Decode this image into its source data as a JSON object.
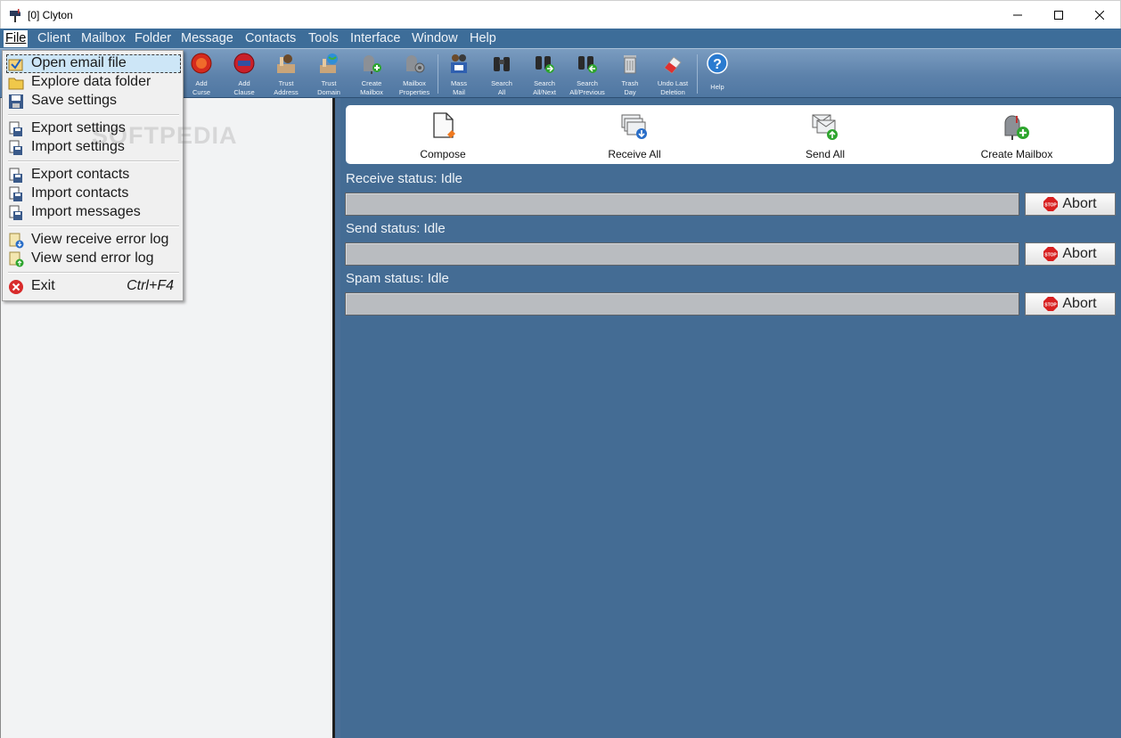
{
  "window": {
    "title": "[0] Clyton"
  },
  "menubar": [
    {
      "label": "File"
    },
    {
      "label": "Client"
    },
    {
      "label": "Mailbox"
    },
    {
      "label": "Folder"
    },
    {
      "label": "Message"
    },
    {
      "label": "Contacts"
    },
    {
      "label": "Tools"
    },
    {
      "label": "Interface"
    },
    {
      "label": "Window"
    },
    {
      "label": "Help"
    }
  ],
  "toolbar": [
    {
      "l1": "Add",
      "l2": "Curse"
    },
    {
      "l1": "Add",
      "l2": "Clause"
    },
    {
      "l1": "Trust",
      "l2": "Address"
    },
    {
      "l1": "Trust",
      "l2": "Domain"
    },
    {
      "l1": "Create",
      "l2": "Mailbox"
    },
    {
      "l1": "Mailbox",
      "l2": "Properties"
    },
    {
      "l1": "Mass",
      "l2": "Mail"
    },
    {
      "l1": "Search",
      "l2": "All"
    },
    {
      "l1": "Search",
      "l2": "All/Next"
    },
    {
      "l1": "Search",
      "l2": "All/Previous"
    },
    {
      "l1": "Trash",
      "l2": "Day"
    },
    {
      "l1": "Undo Last",
      "l2": "Deletion"
    },
    {
      "l1": "Help",
      "l2": ""
    }
  ],
  "quickbar": [
    {
      "label": "Compose"
    },
    {
      "label": "Receive All"
    },
    {
      "label": "Send All"
    },
    {
      "label": "Create Mailbox"
    }
  ],
  "status": {
    "receive": "Receive status: Idle",
    "send": "Send status: Idle",
    "spam": "Spam status: Idle",
    "abort_label": "Abort"
  },
  "file_menu": {
    "items": [
      {
        "label": "Open email file"
      },
      {
        "label": "Explore data folder"
      },
      {
        "label": "Save settings"
      },
      {
        "label": "Export settings"
      },
      {
        "label": "Import settings"
      },
      {
        "label": "Export contacts"
      },
      {
        "label": "Import contacts"
      },
      {
        "label": "Import messages"
      },
      {
        "label": "View receive error log"
      },
      {
        "label": "View send error log"
      },
      {
        "label": "Exit",
        "shortcut": "Ctrl+F4"
      }
    ],
    "watermark": "SOFTPEDIA"
  }
}
